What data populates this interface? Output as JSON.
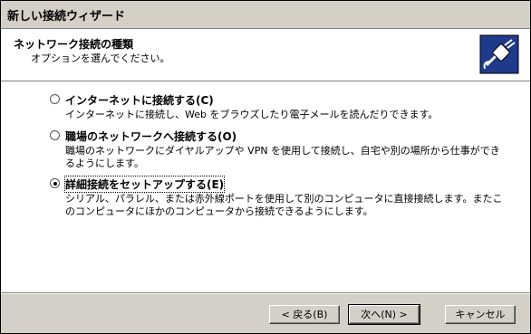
{
  "window": {
    "title": "新しい接続ウィザード"
  },
  "header": {
    "title": "ネットワーク接続の種類",
    "subtitle": "オプションを選んでください。",
    "icon": "network-connection-icon"
  },
  "options": [
    {
      "label": "インターネットに接続する(C)",
      "description": "インターネットに接続し、Web をブラウズしたり電子メールを読んだりできます。",
      "selected": false
    },
    {
      "label": "職場のネットワークへ接続する(O)",
      "description": "職場のネットワークにダイヤルアップや VPN を使用して接続し、自宅や別の場所から仕事ができるようにします。",
      "selected": false
    },
    {
      "label": "詳細接続をセットアップする(E)",
      "description": "シリアル、パラレル、または赤外線ポートを使用して別のコンピュータに直接接続します。またこのコンピュータにほかのコンピュータから接続できるようにします。",
      "selected": true
    }
  ],
  "buttons": {
    "back": "< 戻る(B)",
    "next": "次へ(N) >",
    "cancel": "キャンセル"
  }
}
